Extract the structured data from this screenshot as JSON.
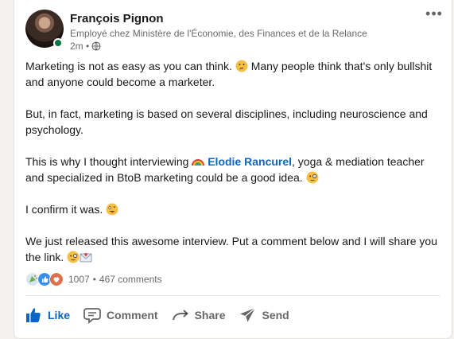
{
  "post": {
    "author": {
      "name": "François Pignon",
      "headline": "Employé chez Ministère de l'Économie, des Finances et de la Relance",
      "time": "2m •",
      "visibility_icon": "globe-icon",
      "status": "online"
    },
    "more_icon": "more-options-icon",
    "body": {
      "p1_text": "Marketing is not as easy as you can think.",
      "p1_cont": "Many people think that's only bullshit and anyone could become a marketer.",
      "p2": "But, in fact, marketing is based on several disciplines, including neuroscience and psychology.",
      "p3_before": "This is why I thought interviewing",
      "mention": "Elodie Rancurel",
      "p3_after": ", yoga & mediation teacher and specialized in BtoB marketing could be a good idea.",
      "p4": "I confirm it was.",
      "p5": "We just released this awesome interview. Put a comment below and I will share you the link."
    },
    "social": {
      "reaction_icons": [
        "celebrate-icon",
        "like-icon",
        "love-icon"
      ],
      "count": "1007",
      "separator": "•",
      "comments": "467 comments"
    },
    "actions": {
      "like": "Like",
      "comment": "Comment",
      "share": "Share",
      "send": "Send"
    }
  },
  "colors": {
    "accent": "#0a66c2",
    "online": "#057642",
    "love": "#df704d"
  }
}
